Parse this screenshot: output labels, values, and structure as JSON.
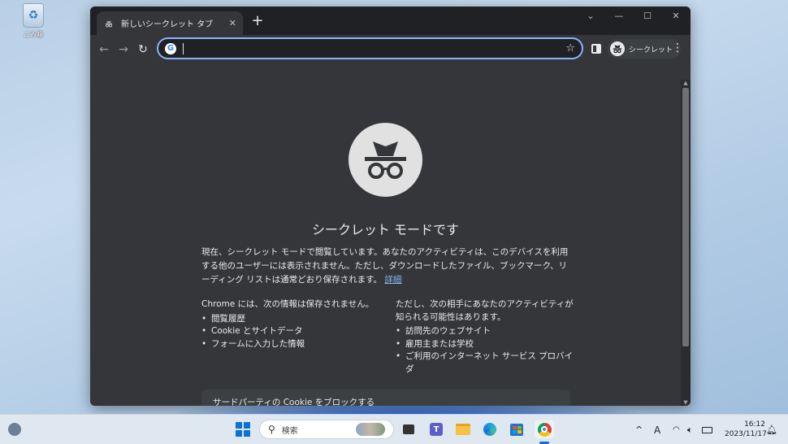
{
  "desktop": {
    "recycle_bin_label": "ごみ箱"
  },
  "browser": {
    "tab": {
      "title": "新しいシークレット タブ",
      "close_glyph": "✕"
    },
    "new_tab_glyph": "+",
    "window_controls": {
      "dropdown": "⌄",
      "minimize": "—",
      "maximize": "☐",
      "close": "✕"
    },
    "toolbar": {
      "back_glyph": "←",
      "forward_glyph": "→",
      "reload_glyph": "↻",
      "omnibox_value": "",
      "profile_label": "シークレット",
      "menu_glyph": "⋮",
      "star_glyph": "☆"
    }
  },
  "page": {
    "heading": "シークレット モードです",
    "intro": "現在、シークレット モードで閲覧しています。あなたのアクティビティは、このデバイスを利用する他のユーザーには表示されません。ただし、ダウンロードしたファイル、ブックマーク、リーディング リストは通常どおり保存されます。",
    "learn_more": "詳細",
    "not_saved": {
      "title": "Chrome には、次の情報は保存されません。",
      "items": [
        "閲覧履歴",
        "Cookie とサイトデータ",
        "フォームに入力した情報"
      ]
    },
    "may_be_visible": {
      "title": "ただし、次の相手にあなたのアクティビティが知られる可能性はあります。",
      "items": [
        "訪問先のウェブサイト",
        "雇用主または学校",
        "ご利用のインターネット サービス プロバイダ"
      ]
    },
    "cookie_card_title": "サードパーティの Cookie をブロックする"
  },
  "taskbar": {
    "search_placeholder": "検索",
    "time": "16:12",
    "date": "2023/11/17",
    "chevron": "^",
    "font_icon": "A"
  }
}
